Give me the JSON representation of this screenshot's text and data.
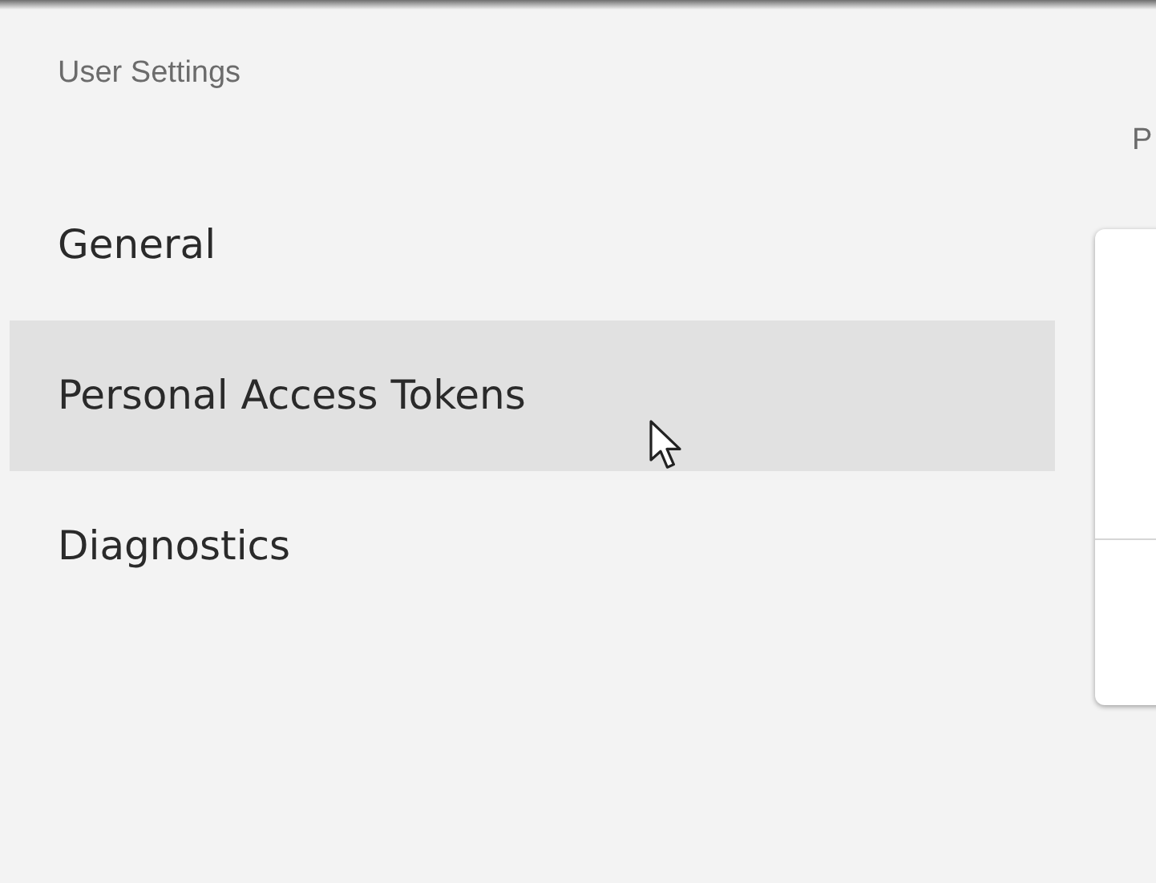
{
  "sidebar": {
    "title": "User Settings",
    "items": [
      {
        "label": "General",
        "selected": false
      },
      {
        "label": "Personal Access Tokens",
        "selected": true
      },
      {
        "label": "Diagnostics",
        "selected": false
      }
    ]
  },
  "main": {
    "heading": "P"
  }
}
